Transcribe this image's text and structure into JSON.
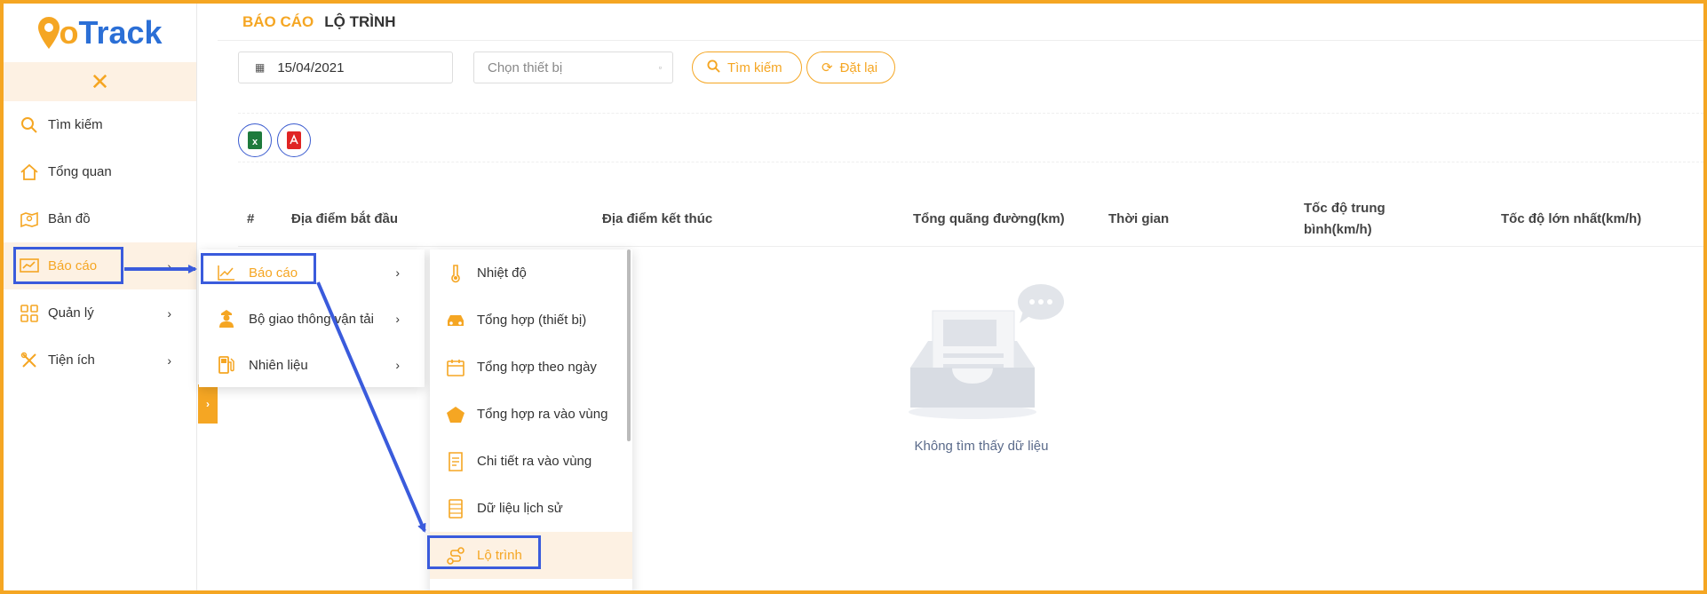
{
  "app": {
    "logo_go": "Go",
    "logo_track": "Track",
    "brand_color": "#f5a623",
    "accent_color": "#2b6fd6"
  },
  "sidebar": {
    "items": [
      {
        "label": "Tìm kiếm",
        "icon": "search-icon"
      },
      {
        "label": "Tổng quan",
        "icon": "home-icon"
      },
      {
        "label": "Bản đồ",
        "icon": "map-icon"
      },
      {
        "label": "Báo cáo",
        "icon": "chart-icon",
        "active": true
      },
      {
        "label": "Quản lý",
        "icon": "grid-icon"
      },
      {
        "label": "Tiện ích",
        "icon": "tools-icon"
      }
    ]
  },
  "breadcrumb": {
    "first": "BÁO CÁO",
    "second": "LỘ TRÌNH"
  },
  "filters": {
    "date_value": "15/04/2021",
    "device_placeholder": "Chọn thiết bị",
    "search_label": "Tìm kiếm",
    "reset_label": "Đặt lại"
  },
  "table": {
    "headers": [
      "#",
      "Địa điểm bắt đầu",
      "Địa điểm kết thúc",
      "Tổng quãng đường(km)",
      "Thời gian",
      "Tốc độ trung bình(km/h)",
      "Tốc độ lớn nhất(km/h)"
    ],
    "empty_text": "Không tìm thấy dữ liệu"
  },
  "submenu1": {
    "items": [
      {
        "label": "Báo cáo",
        "icon": "chart-line-icon"
      },
      {
        "label": "Bộ giao thông vận tải",
        "icon": "officer-icon"
      },
      {
        "label": "Nhiên liệu",
        "icon": "fuel-icon"
      }
    ]
  },
  "submenu2": {
    "items": [
      {
        "label": "Nhiệt độ",
        "icon": "thermometer-icon"
      },
      {
        "label": "Tổng hợp (thiết bị)",
        "icon": "car-icon"
      },
      {
        "label": "Tổng hợp theo ngày",
        "icon": "calendar-icon"
      },
      {
        "label": "Tổng hợp ra vào vùng",
        "icon": "pentagon-icon"
      },
      {
        "label": "Chi tiết ra vào vùng",
        "icon": "document-icon"
      },
      {
        "label": "Dữ liệu lịch sử",
        "icon": "history-icon"
      },
      {
        "label": "Lộ trình",
        "icon": "route-icon",
        "active": true
      }
    ]
  }
}
